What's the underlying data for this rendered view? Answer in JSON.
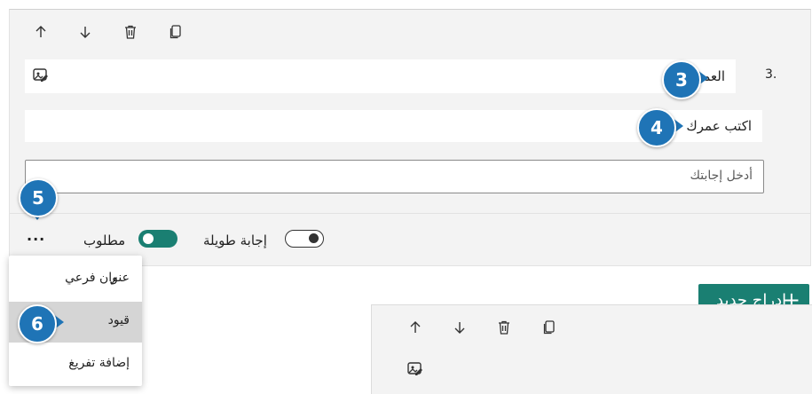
{
  "toolbar": {
    "move_up_icon": "arrow-up-icon",
    "move_down_icon": "arrow-down-icon",
    "delete_icon": "trash-icon",
    "copy_icon": "copy-icon"
  },
  "question": {
    "number": "3.",
    "title": "العمر",
    "subtitle": "اكتب عمرك",
    "answer_placeholder": "أدخل إجابتك"
  },
  "options": {
    "long_answer_label": "إجابة طويلة",
    "long_answer_on": false,
    "required_label": "مطلوب",
    "required_on": true,
    "more_label": "..."
  },
  "menu": {
    "items": [
      {
        "label": "عنوان فرعي",
        "checked": true
      },
      {
        "label": "قيود",
        "checked": false
      },
      {
        "label": "إضافة تفريغ",
        "checked": false
      }
    ]
  },
  "add_button": {
    "label": "إدراج جديد",
    "icon": "+"
  },
  "callouts": [
    "3",
    "4",
    "5",
    "6"
  ],
  "colors": {
    "accent": "#1a7f72",
    "callout": "#1f74b6"
  }
}
